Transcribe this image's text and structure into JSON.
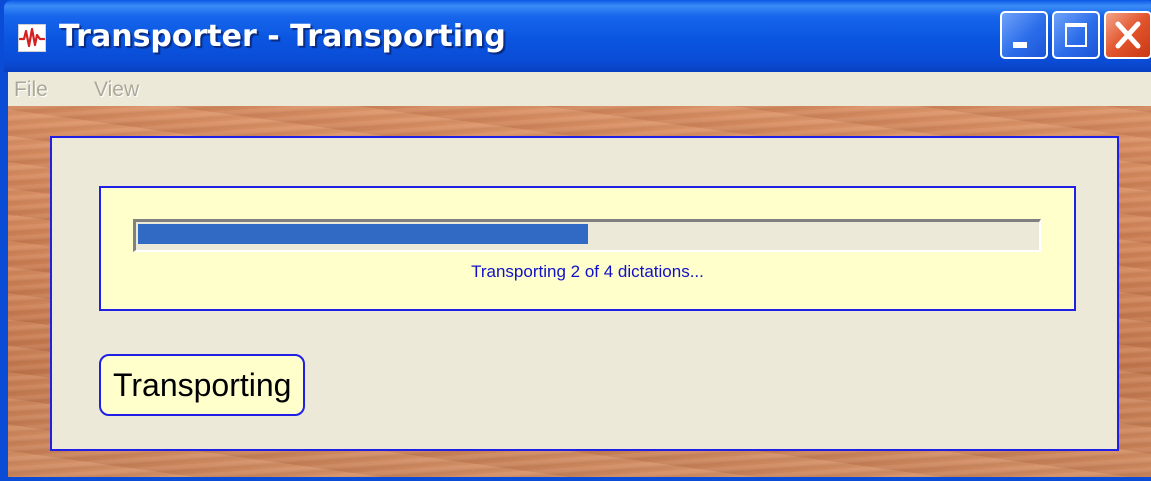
{
  "window": {
    "title": "Transporter - Transporting"
  },
  "menu": {
    "file": "File",
    "view": "View"
  },
  "progress": {
    "fraction": 0.5,
    "status_text": "Transporting 2 of 4 dictations..."
  },
  "state_badge": "Transporting",
  "icons": {
    "app": "waveform-icon",
    "minimize": "minimize-icon",
    "maximize": "maximize-icon",
    "close": "close-icon"
  },
  "colors": {
    "titlebar": "#0A4CD6",
    "progress_fill": "#316AC5",
    "status_text": "#1010C8",
    "panel_border": "#1F1FE6",
    "status_background": "#FFFFCC",
    "close_button": "#E2542C"
  }
}
